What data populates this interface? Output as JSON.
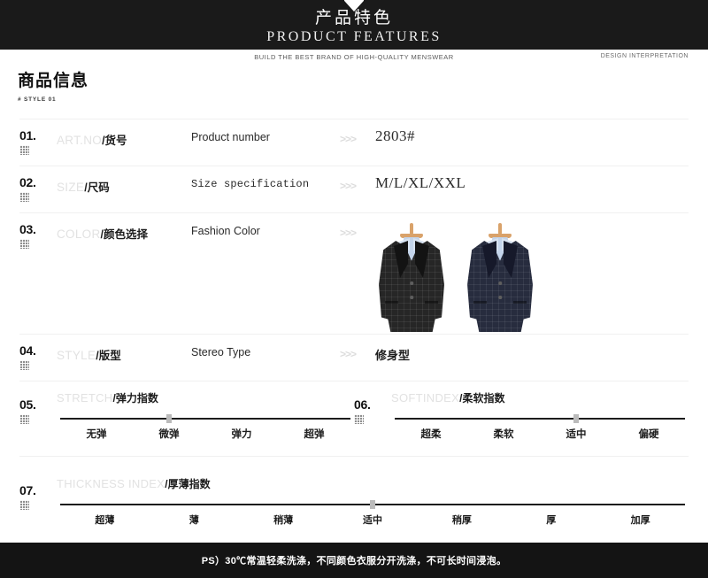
{
  "banner": {
    "title_cn": "产品特色",
    "title_en": "PRODUCT FEATURES",
    "notch_icon": "chevron-down-shield-icon"
  },
  "subheader": {
    "center_text": "BUILD THE BEST BRAND OF HIGH-QUALITY MENSWEAR",
    "right_text": "DESIGN INTERPRETATION"
  },
  "section": {
    "title": "商品信息",
    "subtitle": "# STYLE 01"
  },
  "arrow_separator": ">>>",
  "rows": [
    {
      "num": "01.",
      "label_en": "ART.NO",
      "label_cn": "/货号",
      "desc": "Product number",
      "value": "2803#"
    },
    {
      "num": "02.",
      "label_en": "SIZE",
      "label_cn": "/尺码",
      "desc": "Size specification",
      "value": "M/L/XL/XXL"
    },
    {
      "num": "03.",
      "label_en": "COLOR",
      "label_cn": "/颜色选择",
      "desc": "Fashion Color",
      "value": ""
    },
    {
      "num": "04.",
      "label_en": "STYLE",
      "label_cn": "/版型",
      "desc": "Stereo Type",
      "value": "修身型"
    }
  ],
  "colors": {
    "swatches": [
      {
        "name": "black-blazer",
        "hex": "#262626"
      },
      {
        "name": "navy-blazer",
        "hex": "#272c3e"
      }
    ]
  },
  "scales": {
    "stretch": {
      "num": "05.",
      "label_en": "STRETCH",
      "label_cn": "/弹力指数",
      "ticks": [
        "无弹",
        "微弹",
        "弹力",
        "超弹"
      ],
      "selected_index": 1
    },
    "soft": {
      "num": "06.",
      "label_en": "SOFTINDEX",
      "label_cn": "/柔软指数",
      "ticks": [
        "超柔",
        "柔软",
        "适中",
        "偏硬"
      ],
      "selected_index": 2
    },
    "thickness": {
      "num": "07.",
      "label_en": "THICKNESS INDEX",
      "label_cn": "/厚薄指数",
      "ticks": [
        "超薄",
        "薄",
        "稍薄",
        "适中",
        "稍厚",
        "厚",
        "加厚"
      ],
      "selected_index": 3
    }
  },
  "footer": {
    "note": "PS）30℃常温轻柔洗涤，不同颜色衣服分开洗涤，不可长时间浸泡。"
  },
  "theme": {
    "banner_bg": "#1a1a1a",
    "footer_bg": "#141414",
    "faded_label": "#e2e2e2",
    "text_dark": "#1d1d1d"
  }
}
